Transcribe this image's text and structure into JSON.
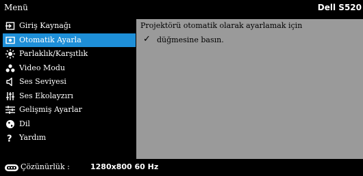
{
  "header": {
    "title": "Menü",
    "brand": "Dell S520"
  },
  "menu": {
    "items": [
      {
        "label": "Giriş Kaynağı",
        "icon": "input-source-icon"
      },
      {
        "label": "Otomatik Ayarla",
        "icon": "auto-adjust-icon",
        "selected": true
      },
      {
        "label": "Parlaklık/Karşıtlık",
        "icon": "brightness-icon"
      },
      {
        "label": "Video Modu",
        "icon": "video-mode-icon"
      },
      {
        "label": "Ses Seviyesi",
        "icon": "speaker-icon"
      },
      {
        "label": "Ses Ekolayzırı",
        "icon": "equalizer-icon"
      },
      {
        "label": "Gelişmiş Ayarlar",
        "icon": "advanced-settings-icon"
      },
      {
        "label": "Dil",
        "icon": "globe-icon"
      },
      {
        "label": "Yardım",
        "icon": "help-icon"
      }
    ]
  },
  "panel": {
    "line1": "Projektörü otomatik olarak ayarlamak için",
    "check_glyph": "✓",
    "line2": "düğmesine basın."
  },
  "footer": {
    "label": "Çözünürlük :",
    "value": "1280x800 60 Hz"
  },
  "colors": {
    "selected": "#1e8fd8",
    "panel": "#9a9a9a",
    "background": "#000000"
  }
}
